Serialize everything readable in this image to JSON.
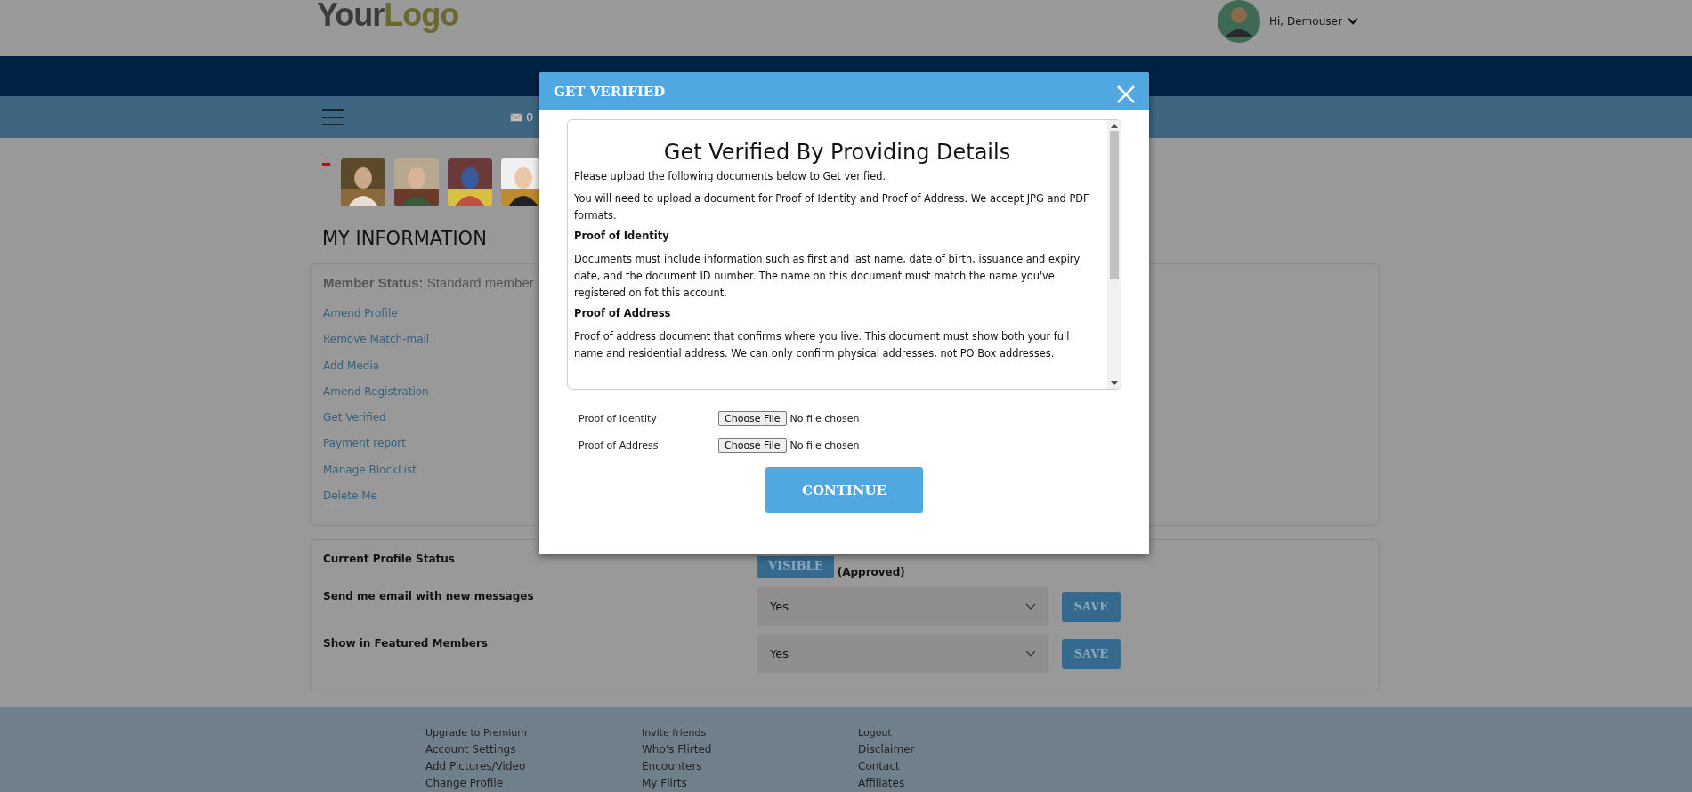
{
  "header": {
    "logo": [
      {
        "text": "Your",
        "color": "#3a3a3a"
      },
      {
        "text": "Logo",
        "color": "#6b6730"
      }
    ],
    "user": {
      "greeting": "Hi, Demouser"
    }
  },
  "nav": {
    "mail_count": "0"
  },
  "section_title": "MY INFORMATION",
  "member_status": {
    "label": "Member Status:",
    "value": "Standard member"
  },
  "links": [
    "Amend Profile",
    "Remove Match-mail",
    "Add Media",
    "Amend Registration",
    "Get Verified",
    "Payment report",
    "Manage BlockList",
    "Delete Me"
  ],
  "settings": [
    {
      "label": "Current Profile Status",
      "kind": "status",
      "status": "VISIBLE",
      "note": "(Approved)"
    },
    {
      "label": "Send me email with new messages",
      "kind": "select",
      "value": "Yes",
      "button": "SAVE"
    },
    {
      "label": "Show in Featured Members",
      "kind": "select",
      "value": "Yes",
      "button": "SAVE"
    }
  ],
  "modal": {
    "title": "GET VERIFIED",
    "heading": "Get Verified By Providing Details",
    "blocks": [
      {
        "kind": "para",
        "text": "Please upload the following documents below to Get verified."
      },
      {
        "kind": "para",
        "text": "You will need to upload a document for Proof of Identity and Proof of Address. We accept JPG and PDF formats."
      },
      {
        "kind": "subhead",
        "text": "Proof of Identity"
      },
      {
        "kind": "para",
        "text": "Documents must include information such as first and last name, date of birth, issuance and expiry date, and the document ID number. The name on this document must match the name you've registered on fot this account."
      },
      {
        "kind": "subhead",
        "text": "Proof of Address"
      },
      {
        "kind": "para",
        "text": "Proof of address document that confirms where you live. This document must show both your full name and residential address. We can only confirm physical addresses, not PO Box addresses."
      }
    ],
    "uploads": [
      {
        "label": "Proof of Identity",
        "button": "Choose File",
        "status": "No file chosen"
      },
      {
        "label": "Proof of Address",
        "button": "Choose File",
        "status": "No file chosen"
      }
    ],
    "submit": "CONTINUE"
  },
  "footer": {
    "columns": [
      [
        "Upgrade to Premium",
        "Account Settings",
        "Add Pictures/Video",
        "Change Profile"
      ],
      [
        "Invite friends",
        "Who's Flirted",
        "Encounters",
        "My Flirts"
      ],
      [
        "Logout",
        "Disclaimer",
        "Contact",
        "Affiliates"
      ]
    ]
  }
}
